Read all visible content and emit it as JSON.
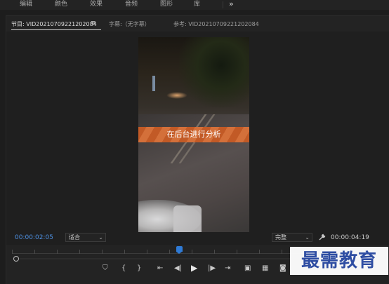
{
  "top_menu": {
    "items": [
      "编辑",
      "颜色",
      "效果",
      "音频",
      "图形",
      "库"
    ],
    "more_label": "»"
  },
  "panel": {
    "tabs": {
      "program": "节目: VID20210709221202084",
      "program_menu": "≡",
      "captions": "字幕:（无字幕）",
      "reference": "参考: VID20210709221202084"
    }
  },
  "video": {
    "banner_text": "在后台进行分析"
  },
  "timecode_bar": {
    "current_timecode": "00:00:02:05",
    "zoom_select": "适合",
    "quality_select": "完整",
    "duration_timecode": "00:00:04:19",
    "wrench_icon": "wrench-icon",
    "chevron": "⌄"
  },
  "controls": {
    "marker": "⛉",
    "in_point": "{",
    "out_point": "}",
    "go_to_in": "⇤",
    "step_back": "◀|",
    "play": "▶",
    "step_forward": "|▶",
    "go_to_out": "⇥",
    "insert": "▣",
    "overwrite": "▦",
    "export_frame": "◙"
  },
  "watermark": {
    "text": "最需教育"
  },
  "colors": {
    "timecode_accent": "#4d8fe0",
    "playhead": "#2f7bd6",
    "watermark": "#2f4fa8"
  }
}
